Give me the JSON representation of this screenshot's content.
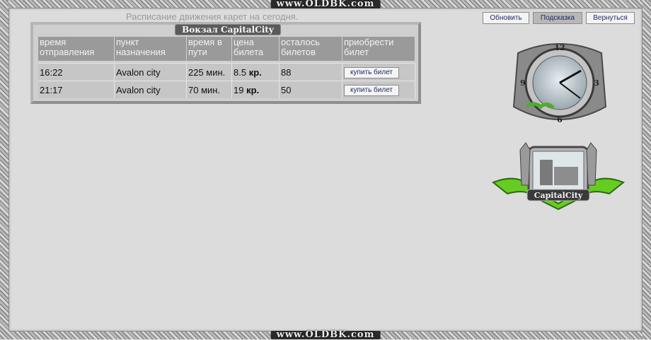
{
  "site": {
    "banner": "www.OLDBK.com"
  },
  "nav": {
    "refresh_label": "Обновить",
    "hint_label": "Подсказка",
    "back_label": "Вернуться"
  },
  "schedule": {
    "caption": "Расписание движения карет на сегодня.",
    "station_title": "Вокзал CapitalCity",
    "headers": {
      "departure": "время отправления",
      "destination": "пункт назначения",
      "duration": "время в пути",
      "price": "цена билета",
      "tickets_left": "осталось билетов",
      "buy": "приобрести билет"
    },
    "rows": [
      {
        "departure": "16:22",
        "destination": "Avalon city",
        "duration": "225 мин.",
        "price": "8.5",
        "price_unit": "кр.",
        "tickets_left": "88",
        "buy_label": "купить билет"
      },
      {
        "departure": "21:17",
        "destination": "Avalon city",
        "duration": "70 мин.",
        "price": "19",
        "price_unit": "кр.",
        "tickets_left": "50",
        "buy_label": "купить билет"
      }
    ]
  },
  "clock": {
    "numerals": [
      "12",
      "3",
      "6",
      "9"
    ]
  },
  "crest": {
    "label": "CapitalCity"
  },
  "colors": {
    "background": "#dcdcdc",
    "header_bg": "#9a9a9a",
    "row_bg": "#c6c6c6",
    "accent_green": "#66cc22",
    "link_blue": "#1a2a6a"
  }
}
